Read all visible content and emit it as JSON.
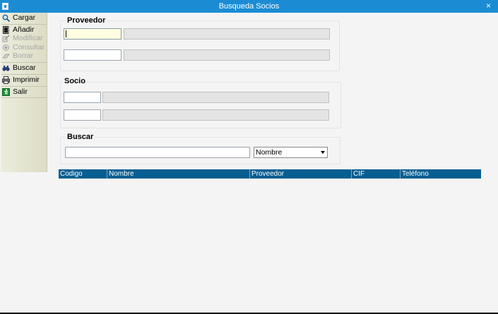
{
  "window": {
    "title": "Busqueda Socios",
    "close_label": "×"
  },
  "toolbar": {
    "items": [
      {
        "label": "Cargar",
        "icon": "magnifier-icon",
        "enabled": true
      },
      {
        "label": "Añadir",
        "icon": "new-document-icon",
        "enabled": true
      },
      {
        "label": "Modificar",
        "icon": "edit-icon",
        "enabled": false
      },
      {
        "label": "Consultar",
        "icon": "view-icon",
        "enabled": false
      },
      {
        "label": "Borrar",
        "icon": "eraser-icon",
        "enabled": false
      },
      {
        "label": "Buscar",
        "icon": "binoculars-icon",
        "enabled": true
      },
      {
        "label": "Imprimir",
        "icon": "printer-icon",
        "enabled": true
      },
      {
        "label": "Salir",
        "icon": "exit-icon",
        "enabled": true
      }
    ]
  },
  "proveedor": {
    "title": "Proveedor",
    "code1": "",
    "name1": "",
    "code2": "",
    "name2": ""
  },
  "socio": {
    "title": "Socio",
    "code1": "",
    "name1": "",
    "code2": "",
    "name2": ""
  },
  "buscar": {
    "title": "Buscar",
    "query": "",
    "field_selected": "Nombre"
  },
  "grid": {
    "columns": [
      "Codigo",
      "Nombre",
      "Proveedor",
      "CIF",
      "Teléfono"
    ]
  },
  "colors": {
    "titlebar": "#1b8cd4",
    "grid_header": "#075e92",
    "active_field": "#fffde0"
  }
}
